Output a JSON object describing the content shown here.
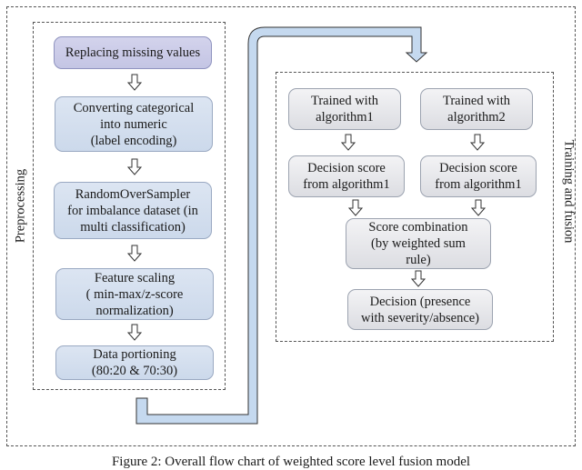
{
  "figure": {
    "caption": "Figure 2: Overall flow chart of weighted score level fusion model"
  },
  "groups": {
    "preprocessing": {
      "label": "Preprocessing",
      "steps": [
        {
          "text": "Replacing missing values",
          "color": "#c9cae7"
        },
        {
          "text": "Converting categorical\ninto numeric\n(label encoding)",
          "color": "#d3deef"
        },
        {
          "text": "RandomOverSampler\nfor imbalance dataset (in\nmulti classification)",
          "color": "#d3deef"
        },
        {
          "text": "Feature scaling\n( min-max/z-score\nnormalization)",
          "color": "#d3deef"
        },
        {
          "text": "Data portioning\n(80:20 & 70:30)",
          "color": "#d3deef"
        }
      ]
    },
    "training_fusion": {
      "label": "Training and fusion",
      "steps": [
        {
          "text": "Trained with\nalgorithm1",
          "color": "#e6e7eb"
        },
        {
          "text": "Trained with\nalgorithm2",
          "color": "#e6e7eb"
        },
        {
          "text": "Decision score\nfrom algorithm1",
          "color": "#e6e7eb"
        },
        {
          "text": "Decision score\nfrom algorithm1",
          "color": "#e6e7eb"
        },
        {
          "text": "Score combination\n(by weighted sum\nrule)",
          "color": "#e6e7eb"
        },
        {
          "text": "Decision (presence\nwith severity/absence)",
          "color": "#e6e7eb"
        }
      ]
    }
  },
  "connector": {
    "color": "#c5d9ef",
    "edge_color": "#333333"
  }
}
